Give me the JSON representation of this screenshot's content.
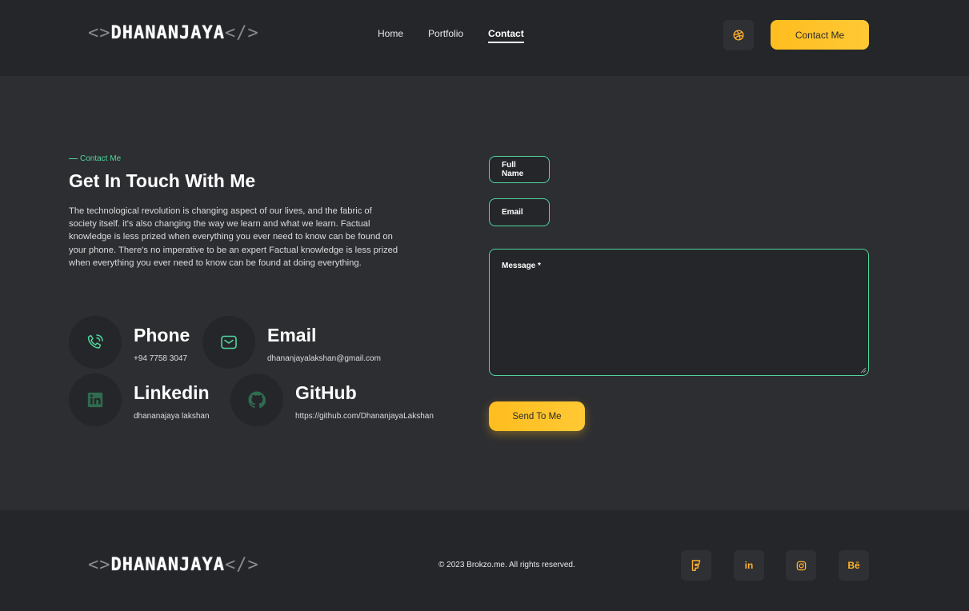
{
  "header": {
    "logo": {
      "open": "<>",
      "name": "DHANANJAYA",
      "close": "</>"
    },
    "nav": [
      {
        "label": "Home",
        "active": false
      },
      {
        "label": "Portfolio",
        "active": false
      },
      {
        "label": "Contact",
        "active": true
      }
    ],
    "dribbble_icon": "dribbble-icon",
    "cta_label": "Contact Me"
  },
  "contact": {
    "eyebrow": "Contact Me",
    "title": "Get In Touch With Me",
    "description": "The technological revolution is changing aspect of our lives, and the fabric of society itself. it's also changing the way we learn and what we learn. Factual knowledge is less prized when everything you ever need to know can be found on your phone. There's no imperative to be an expert Factual knowledge is less prized when everything you ever need to know can be found at doing everything.",
    "items": [
      {
        "icon": "phone-icon",
        "title": "Phone",
        "value": "+94 7758 3047"
      },
      {
        "icon": "mail-icon",
        "title": "Email",
        "value": "dhananjayalakshan@gmail.com"
      },
      {
        "icon": "linkedin-icon",
        "title": "Linkedin",
        "value": "dhananajaya lakshan"
      },
      {
        "icon": "github-icon",
        "title": "GitHub",
        "value": "https://github.com/DhananjayaLakshan"
      }
    ]
  },
  "form": {
    "name_placeholder": "Full Name",
    "email_placeholder": "Email",
    "message_placeholder": "Message *",
    "submit_label": "Send To Me"
  },
  "footer": {
    "logo": {
      "open": "<>",
      "name": "DHANANJAYA",
      "close": "</>"
    },
    "copyright": "© 2023 Brokzo.me. All rights reserved.",
    "social": [
      {
        "icon": "foursquare-icon",
        "glyph": ""
      },
      {
        "icon": "linkedin-icon",
        "glyph": "in"
      },
      {
        "icon": "instagram-icon",
        "glyph": ""
      },
      {
        "icon": "behance-icon",
        "glyph": "Bē"
      }
    ]
  },
  "colors": {
    "accent_green": "#4fd69c",
    "accent_yellow": "#ffbd1f",
    "background": "#2d2e32",
    "panel": "#25262a"
  }
}
